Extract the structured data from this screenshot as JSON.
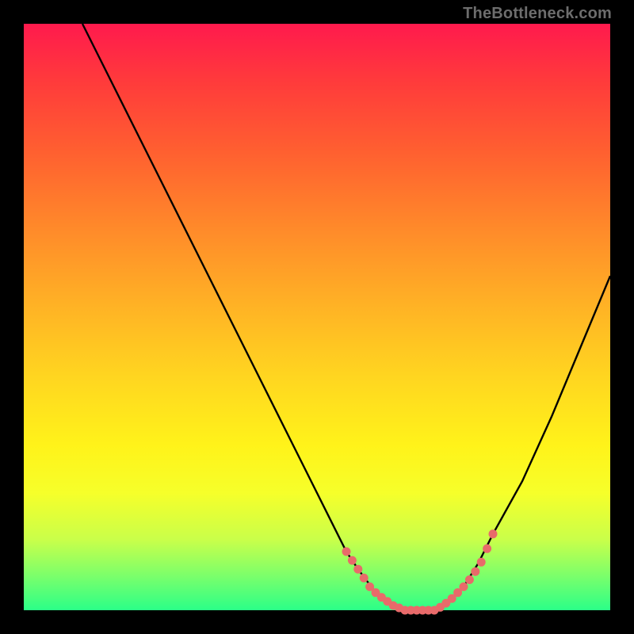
{
  "watermark": "TheBottleneck.com",
  "colors": {
    "background": "#000000",
    "curve_stroke": "#000000",
    "dot_fill": "#e86a6a",
    "gradient_top": "#ff1a4d",
    "gradient_bottom": "#2bff88"
  },
  "chart_data": {
    "type": "line",
    "title": "",
    "xlabel": "",
    "ylabel": "",
    "xlim": [
      0,
      100
    ],
    "ylim": [
      0,
      100
    ],
    "grid": false,
    "legend": false,
    "series": [
      {
        "name": "bottleneck-curve",
        "x": [
          10,
          15,
          20,
          25,
          30,
          35,
          40,
          45,
          50,
          55,
          57,
          60,
          62.5,
          65,
          67.5,
          70,
          72,
          75,
          77.5,
          80,
          85,
          90,
          95,
          100
        ],
        "y": [
          100,
          90,
          80,
          70,
          60,
          50,
          40,
          30,
          20,
          10,
          7,
          3,
          1,
          0,
          0,
          0,
          1,
          4,
          8,
          13,
          22,
          33,
          45,
          57
        ]
      }
    ],
    "dots": {
      "name": "highlight-dots",
      "x": [
        55,
        56,
        57,
        58,
        59,
        60,
        61,
        62,
        63,
        64,
        65,
        66,
        67,
        68,
        69,
        70,
        71,
        72,
        73,
        74,
        75,
        76,
        77,
        78,
        79,
        80
      ],
      "y": [
        10,
        8.5,
        7,
        5.5,
        4,
        3,
        2.2,
        1.5,
        0.8,
        0.4,
        0,
        0,
        0,
        0,
        0,
        0,
        0.5,
        1.2,
        2,
        3,
        4,
        5.2,
        6.6,
        8.2,
        10.5,
        13
      ]
    }
  }
}
